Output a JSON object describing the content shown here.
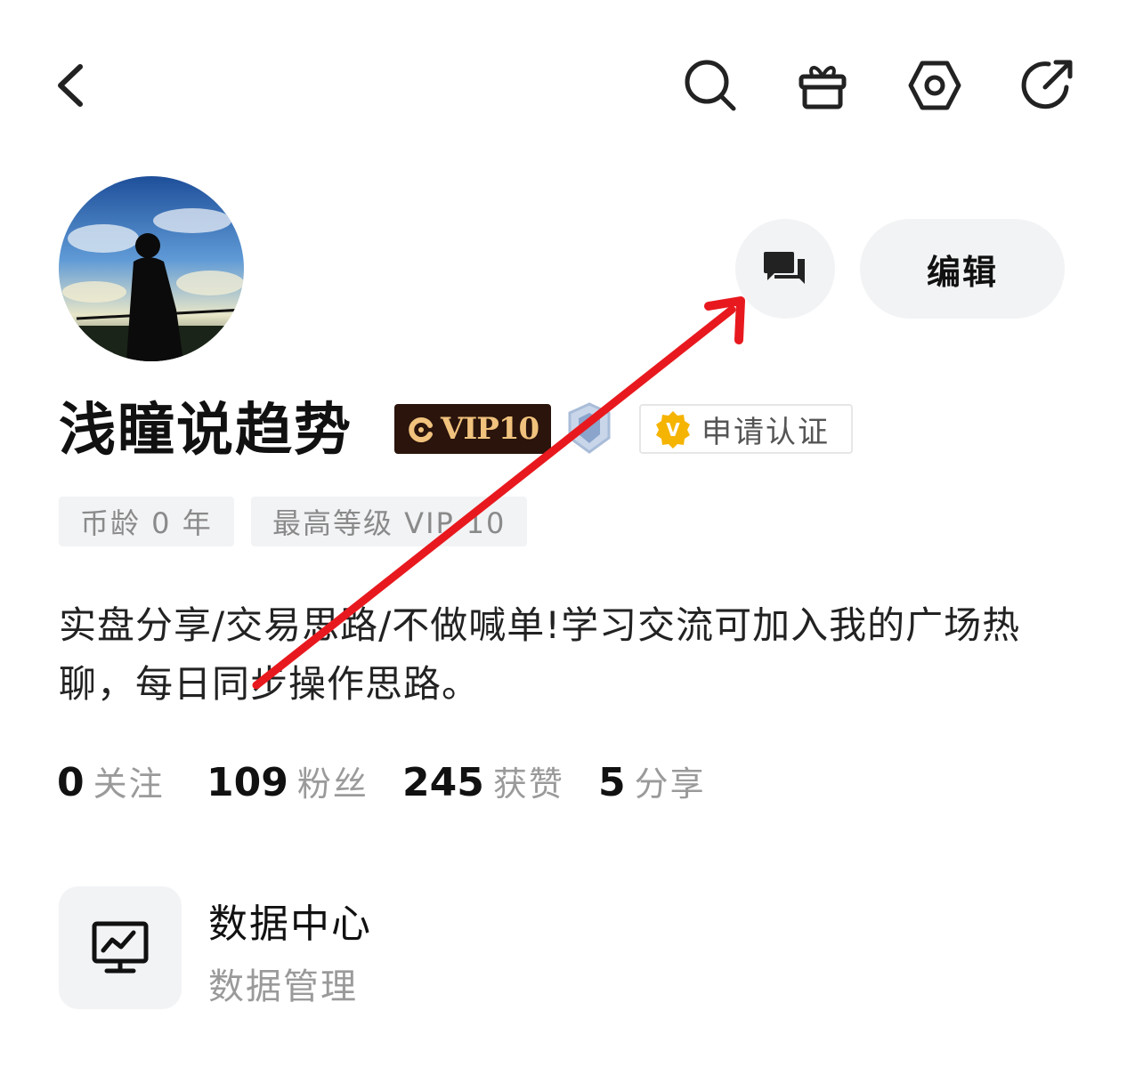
{
  "topbar": {
    "back_icon": "chevron-left-icon",
    "actions": [
      "search-icon",
      "gift-icon",
      "settings-hexagon-icon",
      "share-icon"
    ]
  },
  "profile": {
    "name": "浅瞳说趋势",
    "vip_badge": "VIP10",
    "apply_verify_label": "申请认证",
    "edit_label": "编辑",
    "tags": [
      "币龄 0 年",
      "最高等级 VIP-10"
    ],
    "bio": "实盘分享/交易思路/不做喊单!学习交流可加入我的广场热聊，每日同步操作思路。"
  },
  "stats": [
    {
      "value": "0",
      "label": "关注"
    },
    {
      "value": "109",
      "label": "粉丝"
    },
    {
      "value": "245",
      "label": "获赞"
    },
    {
      "value": "5",
      "label": "分享"
    }
  ],
  "data_center": {
    "title": "数据中心",
    "subtitle": "数据管理",
    "icon": "monitor-chart-icon"
  },
  "colors": {
    "vip_bg": "#2a140c",
    "vip_text": "#f1c27d",
    "verify_badge": "#f5b400",
    "annotation_arrow": "#e8191e"
  }
}
